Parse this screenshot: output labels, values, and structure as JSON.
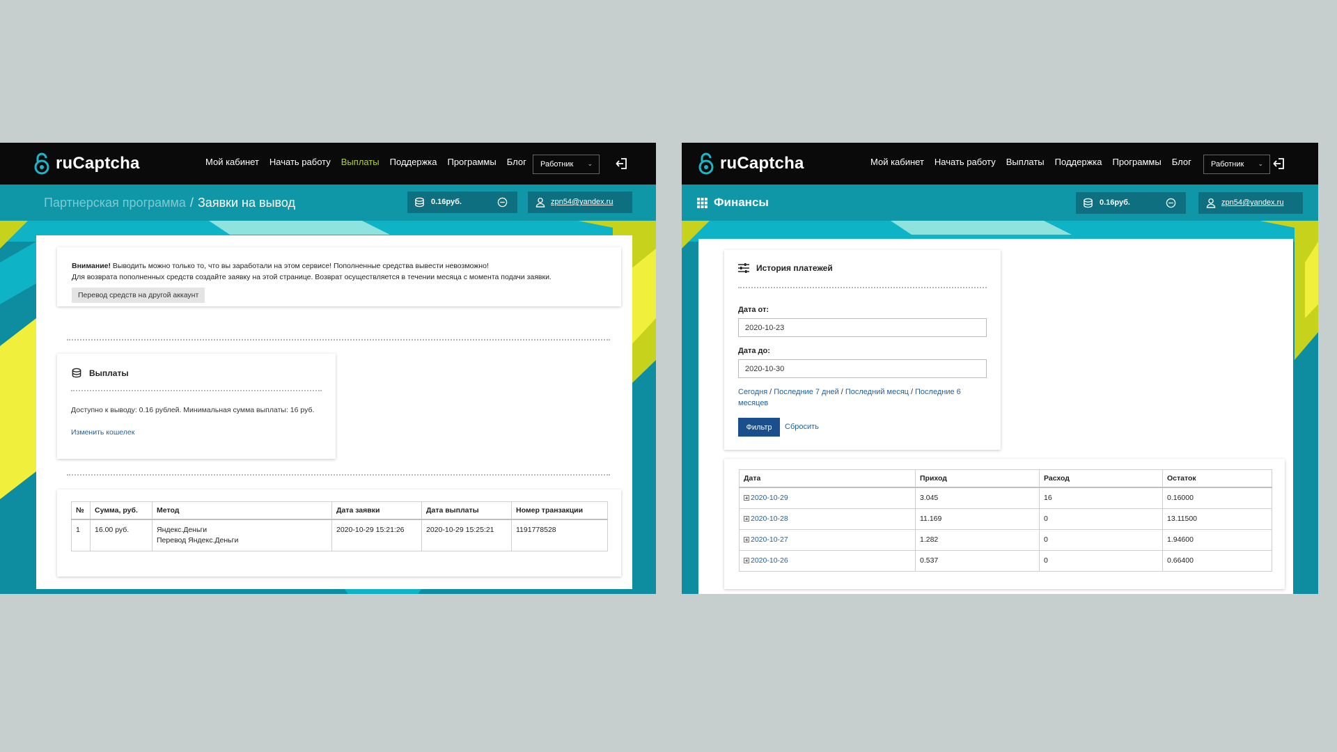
{
  "colors": {
    "page_bg": "#c6cfcd",
    "topbar_bg": "#0a0a0a",
    "subbar_bg": "#0f97a8",
    "teal_dark": "#0f8da0",
    "accent_green": "#b7cf2a",
    "accent_yellow": "#f0f03c",
    "link_blue": "#1f5f9d",
    "button_blue": "#1a4e8c"
  },
  "left": {
    "logo": {
      "text": "ruCaptcha",
      "icon": "padlock-icon"
    },
    "nav": [
      {
        "label": "Мой кабинет",
        "active": false
      },
      {
        "label": "Начать работу",
        "active": false
      },
      {
        "label": "Выплаты",
        "active": true
      },
      {
        "label": "Поддержка",
        "active": false
      },
      {
        "label": "Программы",
        "active": false
      },
      {
        "label": "Блог",
        "active": false
      }
    ],
    "role_select": {
      "value": "Работник"
    },
    "breadcrumb": {
      "parent": "Партнерская программа",
      "separator": "/",
      "current": "Заявки на вывод"
    },
    "balance": {
      "value": "0.16руб."
    },
    "user": {
      "email": "zpn54@yandex.ru"
    },
    "notice": {
      "title": "Внимание!",
      "line1": "Выводить можно только то, что вы заработали на этом сервисе! Пополненные средства вывести невозможно!",
      "line2": "Для возврата пополненных средств создайте заявку на этой странице. Возврат осуществляется в течении месяца с момента подачи заявки.",
      "button": "Перевод средств на другой аккаунт"
    },
    "payouts": {
      "title": "Выплаты",
      "available": "Доступно к выводу: 0.16 рублей. Минимальная сумма выплаты: 16 руб.",
      "change_wallet": "Изменить кошелек"
    },
    "table": {
      "headers": [
        "№",
        "Сумма, руб.",
        "Метод",
        "Дата заявки",
        "Дата выплаты",
        "Номер транзакции"
      ],
      "rows": [
        {
          "num": "1",
          "amount": "16.00 руб.",
          "method1": "Яндекс.Деньги",
          "method2": "Перевод Яндекс.Деньги",
          "request_date": "2020-10-29 15:21:26",
          "payout_date": "2020-10-29 15:25:21",
          "transaction": "1191778528"
        }
      ]
    }
  },
  "right": {
    "logo": {
      "text": "ruCaptcha",
      "icon": "padlock-icon"
    },
    "nav": [
      {
        "label": "Мой кабинет",
        "active": false
      },
      {
        "label": "Начать работу",
        "active": false
      },
      {
        "label": "Выплаты",
        "active": false
      },
      {
        "label": "Поддержка",
        "active": false
      },
      {
        "label": "Программы",
        "active": false
      },
      {
        "label": "Блог",
        "active": false
      }
    ],
    "role_select": {
      "value": "Работник"
    },
    "title": "Финансы",
    "balance": {
      "value": "0.16руб."
    },
    "user": {
      "email": "zpn54@yandex.ru"
    },
    "history": {
      "title": "История платежей",
      "date_from_label": "Дата от:",
      "date_from_value": "2020-10-23",
      "date_to_label": "Дата до:",
      "date_to_value": "2020-10-30",
      "quick": {
        "today": "Сегодня",
        "sep": "/",
        "last7": "Последние 7 дней",
        "last_month": "Последний месяц",
        "last6": "Последние 6 месяцев"
      },
      "filter_button": "Фильтр",
      "reset_link": "Сбросить"
    },
    "table": {
      "headers": [
        "Дата",
        "Приход",
        "Расход",
        "Остаток"
      ],
      "rows": [
        {
          "date": "2020-10-29",
          "income": "3.045",
          "expense": "16",
          "balance": "0.16000"
        },
        {
          "date": "2020-10-28",
          "income": "11.169",
          "expense": "0",
          "balance": "13.11500"
        },
        {
          "date": "2020-10-27",
          "income": "1.282",
          "expense": "0",
          "balance": "1.94600"
        },
        {
          "date": "2020-10-26",
          "income": "0.537",
          "expense": "0",
          "balance": "0.66400"
        }
      ]
    }
  }
}
